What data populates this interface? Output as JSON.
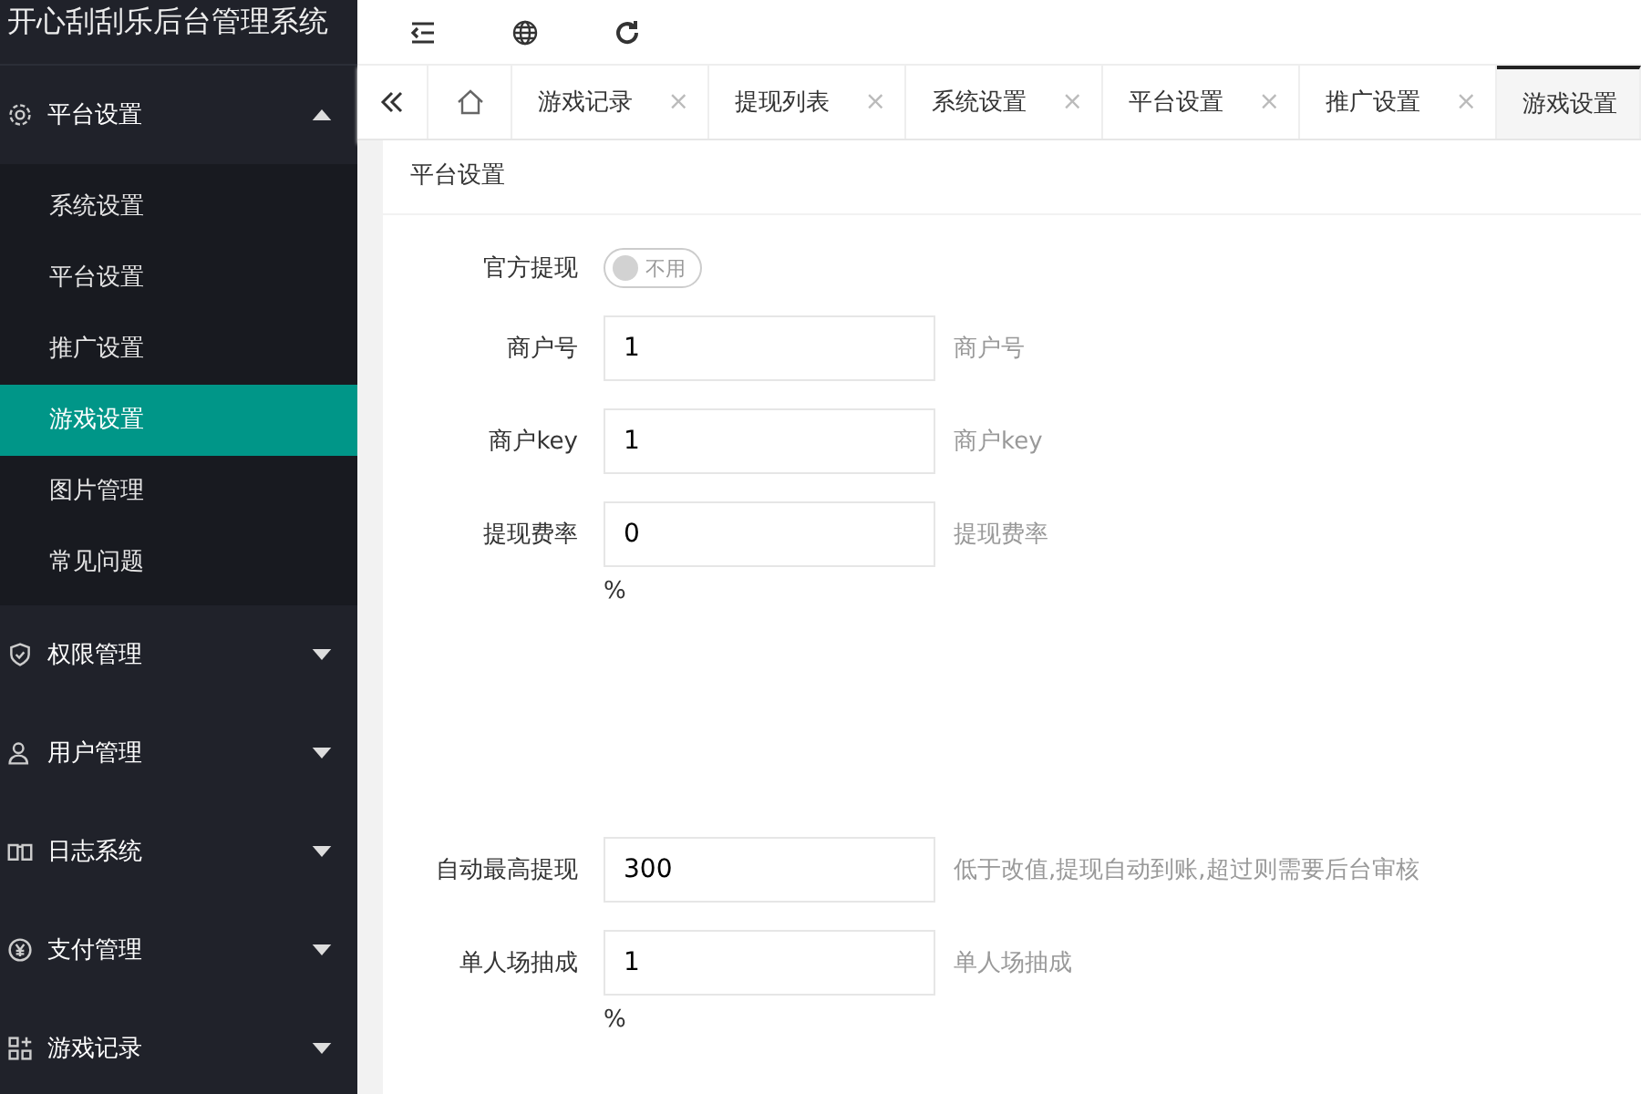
{
  "app_title": "开心刮刮乐后台管理系统",
  "sidebar": {
    "items": [
      {
        "label": "平台设置",
        "expanded": true,
        "children": [
          {
            "label": "系统设置",
            "selected": false
          },
          {
            "label": "平台设置",
            "selected": false
          },
          {
            "label": "推广设置",
            "selected": false
          },
          {
            "label": "游戏设置",
            "selected": true
          },
          {
            "label": "图片管理",
            "selected": false
          },
          {
            "label": "常见问题",
            "selected": false
          }
        ]
      },
      {
        "label": "权限管理",
        "expanded": false
      },
      {
        "label": "用户管理",
        "expanded": false
      },
      {
        "label": "日志系统",
        "expanded": false
      },
      {
        "label": "支付管理",
        "expanded": false
      },
      {
        "label": "游戏记录",
        "expanded": false
      }
    ]
  },
  "tabs": [
    {
      "label": "游戏记录",
      "selected": false,
      "close": "×"
    },
    {
      "label": "提现列表",
      "selected": false,
      "close": "×"
    },
    {
      "label": "系统设置",
      "selected": false,
      "close": "×"
    },
    {
      "label": "平台设置",
      "selected": false,
      "close": "×"
    },
    {
      "label": "推广设置",
      "selected": false,
      "close": "×"
    },
    {
      "label": "游戏设置",
      "selected": true
    }
  ],
  "card_title": "平台设置",
  "fields": [
    {
      "kind": "switch",
      "label": "官方提现",
      "on": false,
      "switch_text": "不用"
    },
    {
      "kind": "input",
      "label": "商户号",
      "value": "1",
      "hint": "商户号"
    },
    {
      "kind": "input",
      "label": "商户key",
      "value": "1",
      "hint": "商户key"
    },
    {
      "kind": "input",
      "label": "提现费率",
      "value": "0",
      "hint": "提现费率",
      "unit": "%"
    },
    {
      "kind": "spacer"
    },
    {
      "kind": "input",
      "label": "自动最高提现",
      "value": "300",
      "hint": "低于改值,提现自动到账,超过则需要后台审核"
    },
    {
      "kind": "input",
      "label": "单人场抽成",
      "value": "1",
      "hint": "单人场抽成",
      "unit": "%"
    }
  ]
}
